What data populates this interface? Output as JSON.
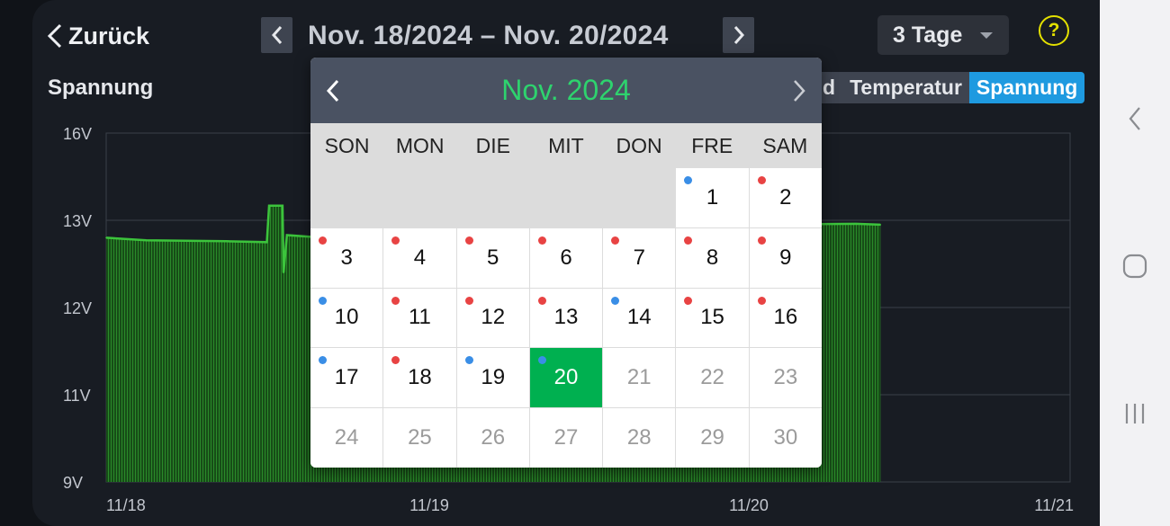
{
  "header": {
    "back_label": "Zurück",
    "range_text": "Nov. 18/2024  –  Nov. 20/2024",
    "period_label": "3 Tage",
    "help_label": "?"
  },
  "section_title": "Spannung",
  "tabs": [
    {
      "label": "d",
      "active": false
    },
    {
      "label": "Temperatur",
      "active": false
    },
    {
      "label": "Spannung",
      "active": true
    }
  ],
  "chart_data": {
    "type": "area",
    "title": "Spannung",
    "y_unit": "V",
    "y_ticks": [
      "16V",
      "13V",
      "12V",
      "11V",
      "9V"
    ],
    "x_ticks": [
      "11/18",
      "11/19",
      "11/20",
      "11/21"
    ],
    "line_color": "#3cc43c",
    "fill_color": "#1f6b1f",
    "series": [
      {
        "values": [
          {
            "x": "11/18 00:00",
            "y": 12.8
          },
          {
            "x": "11/18 03:00",
            "y": 12.77
          },
          {
            "x": "11/18 09:00",
            "y": 12.76
          },
          {
            "x": "11/18 12:00",
            "y": 12.75
          },
          {
            "x": "11/18 12:10",
            "y": 13.5
          },
          {
            "x": "11/18 13:10",
            "y": 13.5
          },
          {
            "x": "11/18 13:15",
            "y": 12.4
          },
          {
            "x": "11/18 13:30",
            "y": 12.83
          },
          {
            "x": "11/18 18:00",
            "y": 12.78
          },
          {
            "x": "11/20 00:00",
            "y": 12.95
          },
          {
            "x": "11/20 08:00",
            "y": 12.96
          },
          {
            "x": "11/20 09:50",
            "y": 12.95
          }
        ]
      }
    ]
  },
  "calendar": {
    "month_label": "Nov. 2024",
    "weekdays": [
      "SON",
      "MON",
      "DIE",
      "MIT",
      "DON",
      "FRE",
      "SAM"
    ],
    "dot_colors": {
      "red": "#e84343",
      "blue": "#3a8ee6"
    },
    "selected_color": "#00b050",
    "days": [
      {
        "label": "",
        "kind": "empty"
      },
      {
        "label": "",
        "kind": "empty"
      },
      {
        "label": "",
        "kind": "empty"
      },
      {
        "label": "",
        "kind": "empty"
      },
      {
        "label": "",
        "kind": "empty"
      },
      {
        "label": "1",
        "kind": "active",
        "dot": "blue"
      },
      {
        "label": "2",
        "kind": "active",
        "dot": "red"
      },
      {
        "label": "3",
        "kind": "active",
        "dot": "red"
      },
      {
        "label": "4",
        "kind": "active",
        "dot": "red"
      },
      {
        "label": "5",
        "kind": "active",
        "dot": "red"
      },
      {
        "label": "6",
        "kind": "active",
        "dot": "red"
      },
      {
        "label": "7",
        "kind": "active",
        "dot": "red"
      },
      {
        "label": "8",
        "kind": "active",
        "dot": "red"
      },
      {
        "label": "9",
        "kind": "active",
        "dot": "red"
      },
      {
        "label": "10",
        "kind": "active",
        "dot": "blue"
      },
      {
        "label": "11",
        "kind": "active",
        "dot": "red"
      },
      {
        "label": "12",
        "kind": "active",
        "dot": "red"
      },
      {
        "label": "13",
        "kind": "active",
        "dot": "red"
      },
      {
        "label": "14",
        "kind": "active",
        "dot": "blue"
      },
      {
        "label": "15",
        "kind": "active",
        "dot": "red"
      },
      {
        "label": "16",
        "kind": "active",
        "dot": "red"
      },
      {
        "label": "17",
        "kind": "active",
        "dot": "blue"
      },
      {
        "label": "18",
        "kind": "active",
        "dot": "red"
      },
      {
        "label": "19",
        "kind": "active",
        "dot": "blue"
      },
      {
        "label": "20",
        "kind": "selected",
        "dot": "blue"
      },
      {
        "label": "21",
        "kind": "muted"
      },
      {
        "label": "22",
        "kind": "muted"
      },
      {
        "label": "23",
        "kind": "muted"
      },
      {
        "label": "24",
        "kind": "muted"
      },
      {
        "label": "25",
        "kind": "muted"
      },
      {
        "label": "26",
        "kind": "muted"
      },
      {
        "label": "27",
        "kind": "muted"
      },
      {
        "label": "28",
        "kind": "muted"
      },
      {
        "label": "29",
        "kind": "muted"
      },
      {
        "label": "30",
        "kind": "muted"
      }
    ]
  },
  "system_nav": {
    "back_icon": "chevron-left-icon",
    "home_icon": "rounded-square-icon",
    "recents_icon": "three-bars-icon"
  }
}
